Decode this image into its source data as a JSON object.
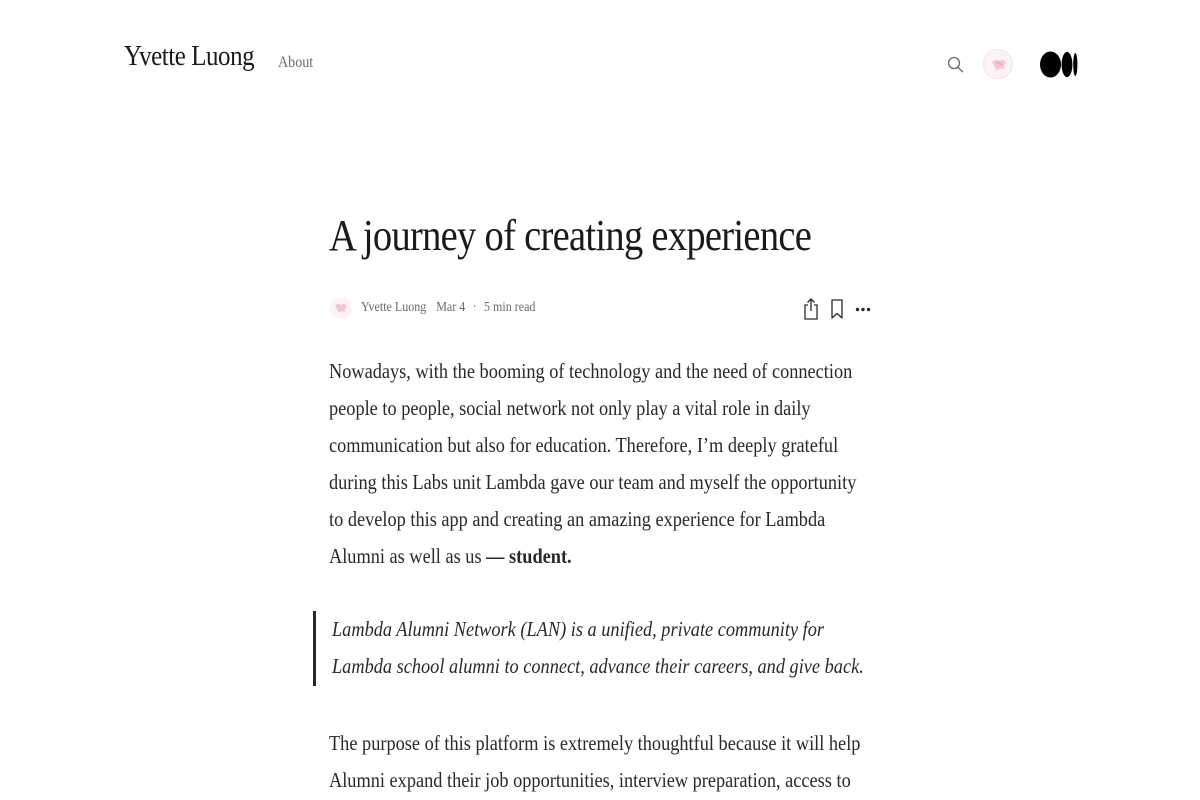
{
  "header": {
    "brand": "Yvette Luong",
    "nav_about": "About",
    "icons": {
      "search": "search-icon",
      "avatar": "avatar",
      "logo": "medium-logo-icon"
    }
  },
  "article": {
    "title": "A journey of creating experience",
    "meta": {
      "author": "Yvette Luong",
      "date": "Mar 4",
      "separator": "·",
      "read_time": "5 min read"
    },
    "actions": {
      "share": "share-icon",
      "bookmark": "bookmark-icon",
      "more": "more-icon"
    },
    "paragraph1": "Nowadays, with the booming of technology and the need of connection people to people, social network not only play a vital role in daily communication but also for education. Therefore, I’m deeply grateful during this Labs unit Lambda gave our team and myself the opportunity to develop this app and creating an amazing experience for Lambda Alumni as well as us",
    "paragraph1_bold": "— student.",
    "quote": "Lambda Alumni Network (LAN) is a unified, private community for Lambda school alumni to connect, advance their careers, and give back.",
    "paragraph2": "The purpose of this platform is extremely thoughtful because it will help Alumni expand their job opportunities, interview preparation, access to"
  },
  "colors": {
    "text": "#292929",
    "muted": "#6b6b6b",
    "avatar_bg": "#fbf3f5"
  }
}
